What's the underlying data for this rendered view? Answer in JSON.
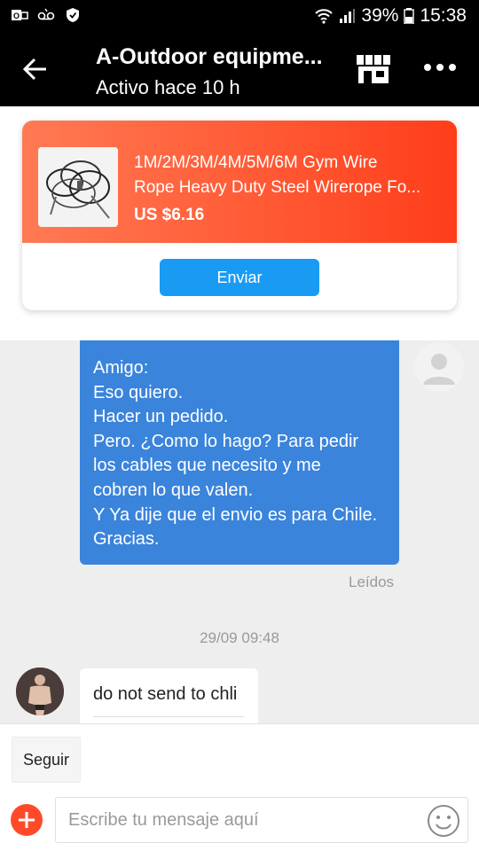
{
  "status_bar": {
    "battery": "39%",
    "time": "15:38"
  },
  "header": {
    "title": "A-Outdoor equipme...",
    "subtitle": "Activo hace 10 h"
  },
  "product": {
    "title_line1": "1M/2M/3M/4M/5M/6M Gym Wire",
    "title_line2": "Rope Heavy Duty Steel Wirerope Fo...",
    "price": "US $6.16",
    "send_label": "Enviar"
  },
  "messages": {
    "outgoing": {
      "lines": [
        "Amigo:",
        "Eso quiero.",
        "Hacer un pedido.",
        "Pero. ¿Como lo hago? Para pedir",
        "los cables que necesito y me",
        "cobren lo que valen.",
        "Y Ya dije que el envio es para Chile.",
        "Gracias."
      ],
      "status": "Leídos"
    },
    "timestamp": "29/09 09:48",
    "incoming": {
      "text": "do not send to chli"
    }
  },
  "bottom": {
    "follow_label": "Seguir",
    "input_placeholder": "Escribe tu mensaje aquí"
  },
  "colors": {
    "header_bg": "#000000",
    "product_gradient_start": "#ff7a54",
    "product_gradient_end": "#ff3d1a",
    "send_button": "#1a9bf3",
    "outgoing_bubble": "#3a84dc",
    "plus_button": "#ff4a2a"
  },
  "icons": {
    "back": "arrow-left-icon",
    "store": "store-icon",
    "more": "more-horizontal-icon",
    "plus": "plus-icon",
    "emoji": "smiley-icon"
  }
}
